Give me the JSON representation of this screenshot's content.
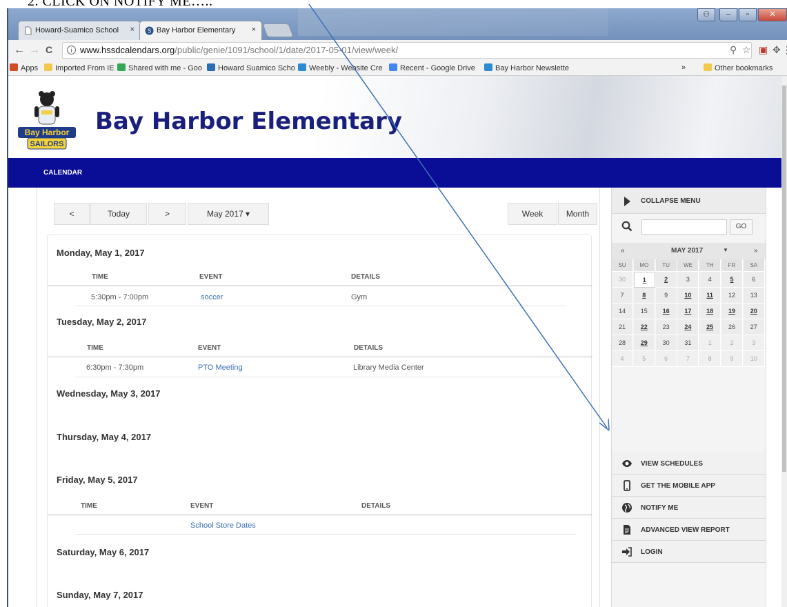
{
  "caption": {
    "text": "2.   CLICK ON NOTIFY ME….."
  },
  "browser": {
    "tabs": [
      {
        "label": "Howard-Suamico School"
      },
      {
        "label": "Bay Harbor Elementary"
      }
    ],
    "tab_close": "×",
    "url": {
      "domain": "www.hssdcalendars.org",
      "path": "/public/genie/1091/school/1/date/2017-05-01/view/week/"
    },
    "nav": {
      "back": "←",
      "forward": "→",
      "reload": "C",
      "info": "i"
    },
    "bookmarks": [
      {
        "label": "Apps",
        "icon": "apps-grid-icon",
        "color": "#d14b2a"
      },
      {
        "label": "Imported From IE",
        "icon": "folder-icon",
        "color": "#f2c94c"
      },
      {
        "label": "Shared with me - Goo",
        "icon": "google-drive-icon",
        "color": "#34a853"
      },
      {
        "label": "Howard Suamico Scho",
        "icon": "calendar-16-icon",
        "color": "#2d6db5"
      },
      {
        "label": "Weebly - Website Cre",
        "icon": "weebly-icon",
        "color": "#2e8bd3"
      },
      {
        "label": "Recent - Google Drive",
        "icon": "google-icon",
        "color": "#4285f4"
      },
      {
        "label": "Bay Harbor Newslette",
        "icon": "weebly-icon",
        "color": "#2e8bd3"
      }
    ],
    "bookmarks_more": "»",
    "other_bookmarks": "Other bookmarks"
  },
  "site": {
    "title": "Bay Harbor Elementary",
    "logo_text": "Bay Harbor SAILORS",
    "nav_item": "CALENDAR"
  },
  "controls": {
    "prev": "<",
    "today": "Today",
    "next": ">",
    "month_select": "May 2017 ▾",
    "week": "Week",
    "month": "Month"
  },
  "columns": {
    "time": "TIME",
    "event": "EVENT",
    "details": "DETAILS"
  },
  "days": [
    {
      "heading": "Monday, May 1, 2017",
      "time": "5:30pm - 7:00pm",
      "event": "soccer",
      "details": "Gym"
    },
    {
      "heading": "Tuesday, May 2, 2017",
      "time": "6:30pm - 7:30pm",
      "event": "PTO Meeting",
      "details": "Library Media Center"
    },
    {
      "heading": "Wednesday, May 3, 2017"
    },
    {
      "heading": "Thursday, May 4, 2017"
    },
    {
      "heading": "Friday, May 5, 2017",
      "time": "",
      "event": "School Store Dates",
      "details": ""
    },
    {
      "heading": "Saturday, May 6, 2017"
    },
    {
      "heading": "Sunday, May 7, 2017"
    }
  ],
  "sidebar": {
    "collapse": "COLLAPSE MENU",
    "search_go": "GO",
    "mini_cal": {
      "prev": "«",
      "title": "MAY 2017",
      "dropdown": "▼",
      "next": "»",
      "dow": [
        "SU",
        "MO",
        "TU",
        "WE",
        "TH",
        "FR",
        "SA"
      ],
      "weeks": [
        [
          "30",
          "1",
          "2",
          "3",
          "4",
          "5",
          "6"
        ],
        [
          "7",
          "8",
          "9",
          "10",
          "11",
          "12",
          "13"
        ],
        [
          "14",
          "15",
          "16",
          "17",
          "18",
          "19",
          "20"
        ],
        [
          "21",
          "22",
          "23",
          "24",
          "25",
          "26",
          "27"
        ],
        [
          "28",
          "29",
          "30",
          "31",
          "1",
          "2",
          "3"
        ],
        [
          "4",
          "5",
          "6",
          "7",
          "8",
          "9",
          "10"
        ]
      ],
      "event_days": [
        "1",
        "2",
        "5",
        "8",
        "10",
        "11",
        "16",
        "17",
        "18",
        "19",
        "20",
        "22",
        "24",
        "25",
        "29"
      ]
    },
    "menu": [
      {
        "label": "VIEW SCHEDULES",
        "icon": "eye-icon"
      },
      {
        "label": "GET THE MOBILE APP",
        "icon": "phone-icon"
      },
      {
        "label": "NOTIFY ME",
        "icon": "globe-icon"
      },
      {
        "label": "ADVANCED VIEW REPORT",
        "icon": "document-icon"
      },
      {
        "label": "LOGIN",
        "icon": "sign-in-icon"
      }
    ]
  },
  "colors": {
    "nav_blue": "#0a0d96",
    "title_blue": "#1a1f7d",
    "link_blue": "#3a6fb3",
    "arrow_blue": "#3d6fb8"
  }
}
